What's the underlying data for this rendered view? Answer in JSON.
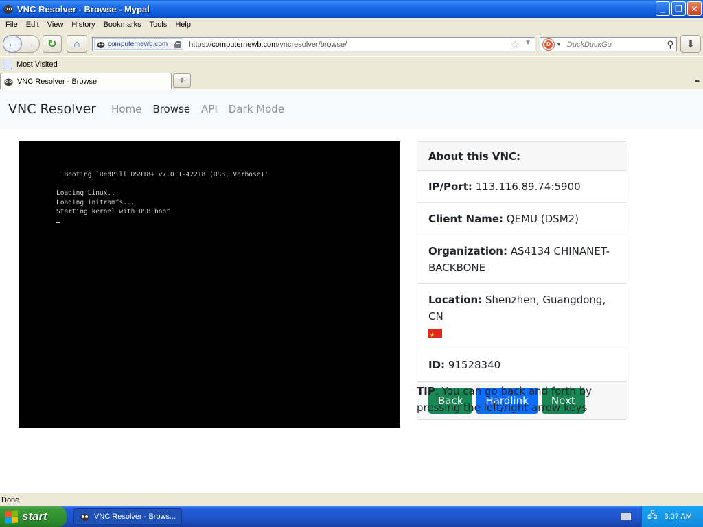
{
  "window": {
    "title": "VNC Resolver - Browse - Mypal"
  },
  "menu": [
    "File",
    "Edit",
    "View",
    "History",
    "Bookmarks",
    "Tools",
    "Help"
  ],
  "toolbar": {
    "site_identity": "computernewb.com",
    "url_prefix": "https://",
    "url_domain": "computernewb.com",
    "url_path": "/vncresolver/browse/",
    "search_placeholder": "DuckDuckGo"
  },
  "bookmarks": {
    "most_visited": "Most Visited"
  },
  "tab": {
    "title": "VNC Resolver - Browse",
    "new_tab": "+"
  },
  "site": {
    "brand": "VNC Resolver",
    "nav": [
      "Home",
      "Browse",
      "API",
      "Dark Mode"
    ],
    "active_nav": "Browse"
  },
  "screen": {
    "lines": [
      "  Booting `RedPill DS918+ v7.0.1-42218 (USB, Verbose)'",
      "",
      "Loading Linux...",
      "Loading initramfs...",
      "Starting kernel with USB boot"
    ]
  },
  "card": {
    "header": "About this VNC:",
    "ip_label": "IP/Port:",
    "ip_value": "113.116.89.74:5900",
    "client_label": "Client Name:",
    "client_value": "QEMU (DSM2)",
    "org_label": "Organization:",
    "org_value": "AS4134 CHINANET-BACKBONE",
    "loc_label": "Location:",
    "loc_value": "Shenzhen, Guangdong, CN",
    "id_label": "ID:",
    "id_value": "91528340",
    "buttons": {
      "back": "Back",
      "hardlink": "Hardlink",
      "next": "Next"
    }
  },
  "tip": {
    "label": "TIP",
    "text": ": You can go back and forth by pressing the left/right arrow keys"
  },
  "status": {
    "text": "Done"
  },
  "taskbar": {
    "start": "start",
    "task": "VNC Resolver - Brows...",
    "clock": "3:07 AM"
  },
  "colors": {
    "success": "#198754",
    "primary": "#0d6efd",
    "xp_blue": "#245edb"
  }
}
